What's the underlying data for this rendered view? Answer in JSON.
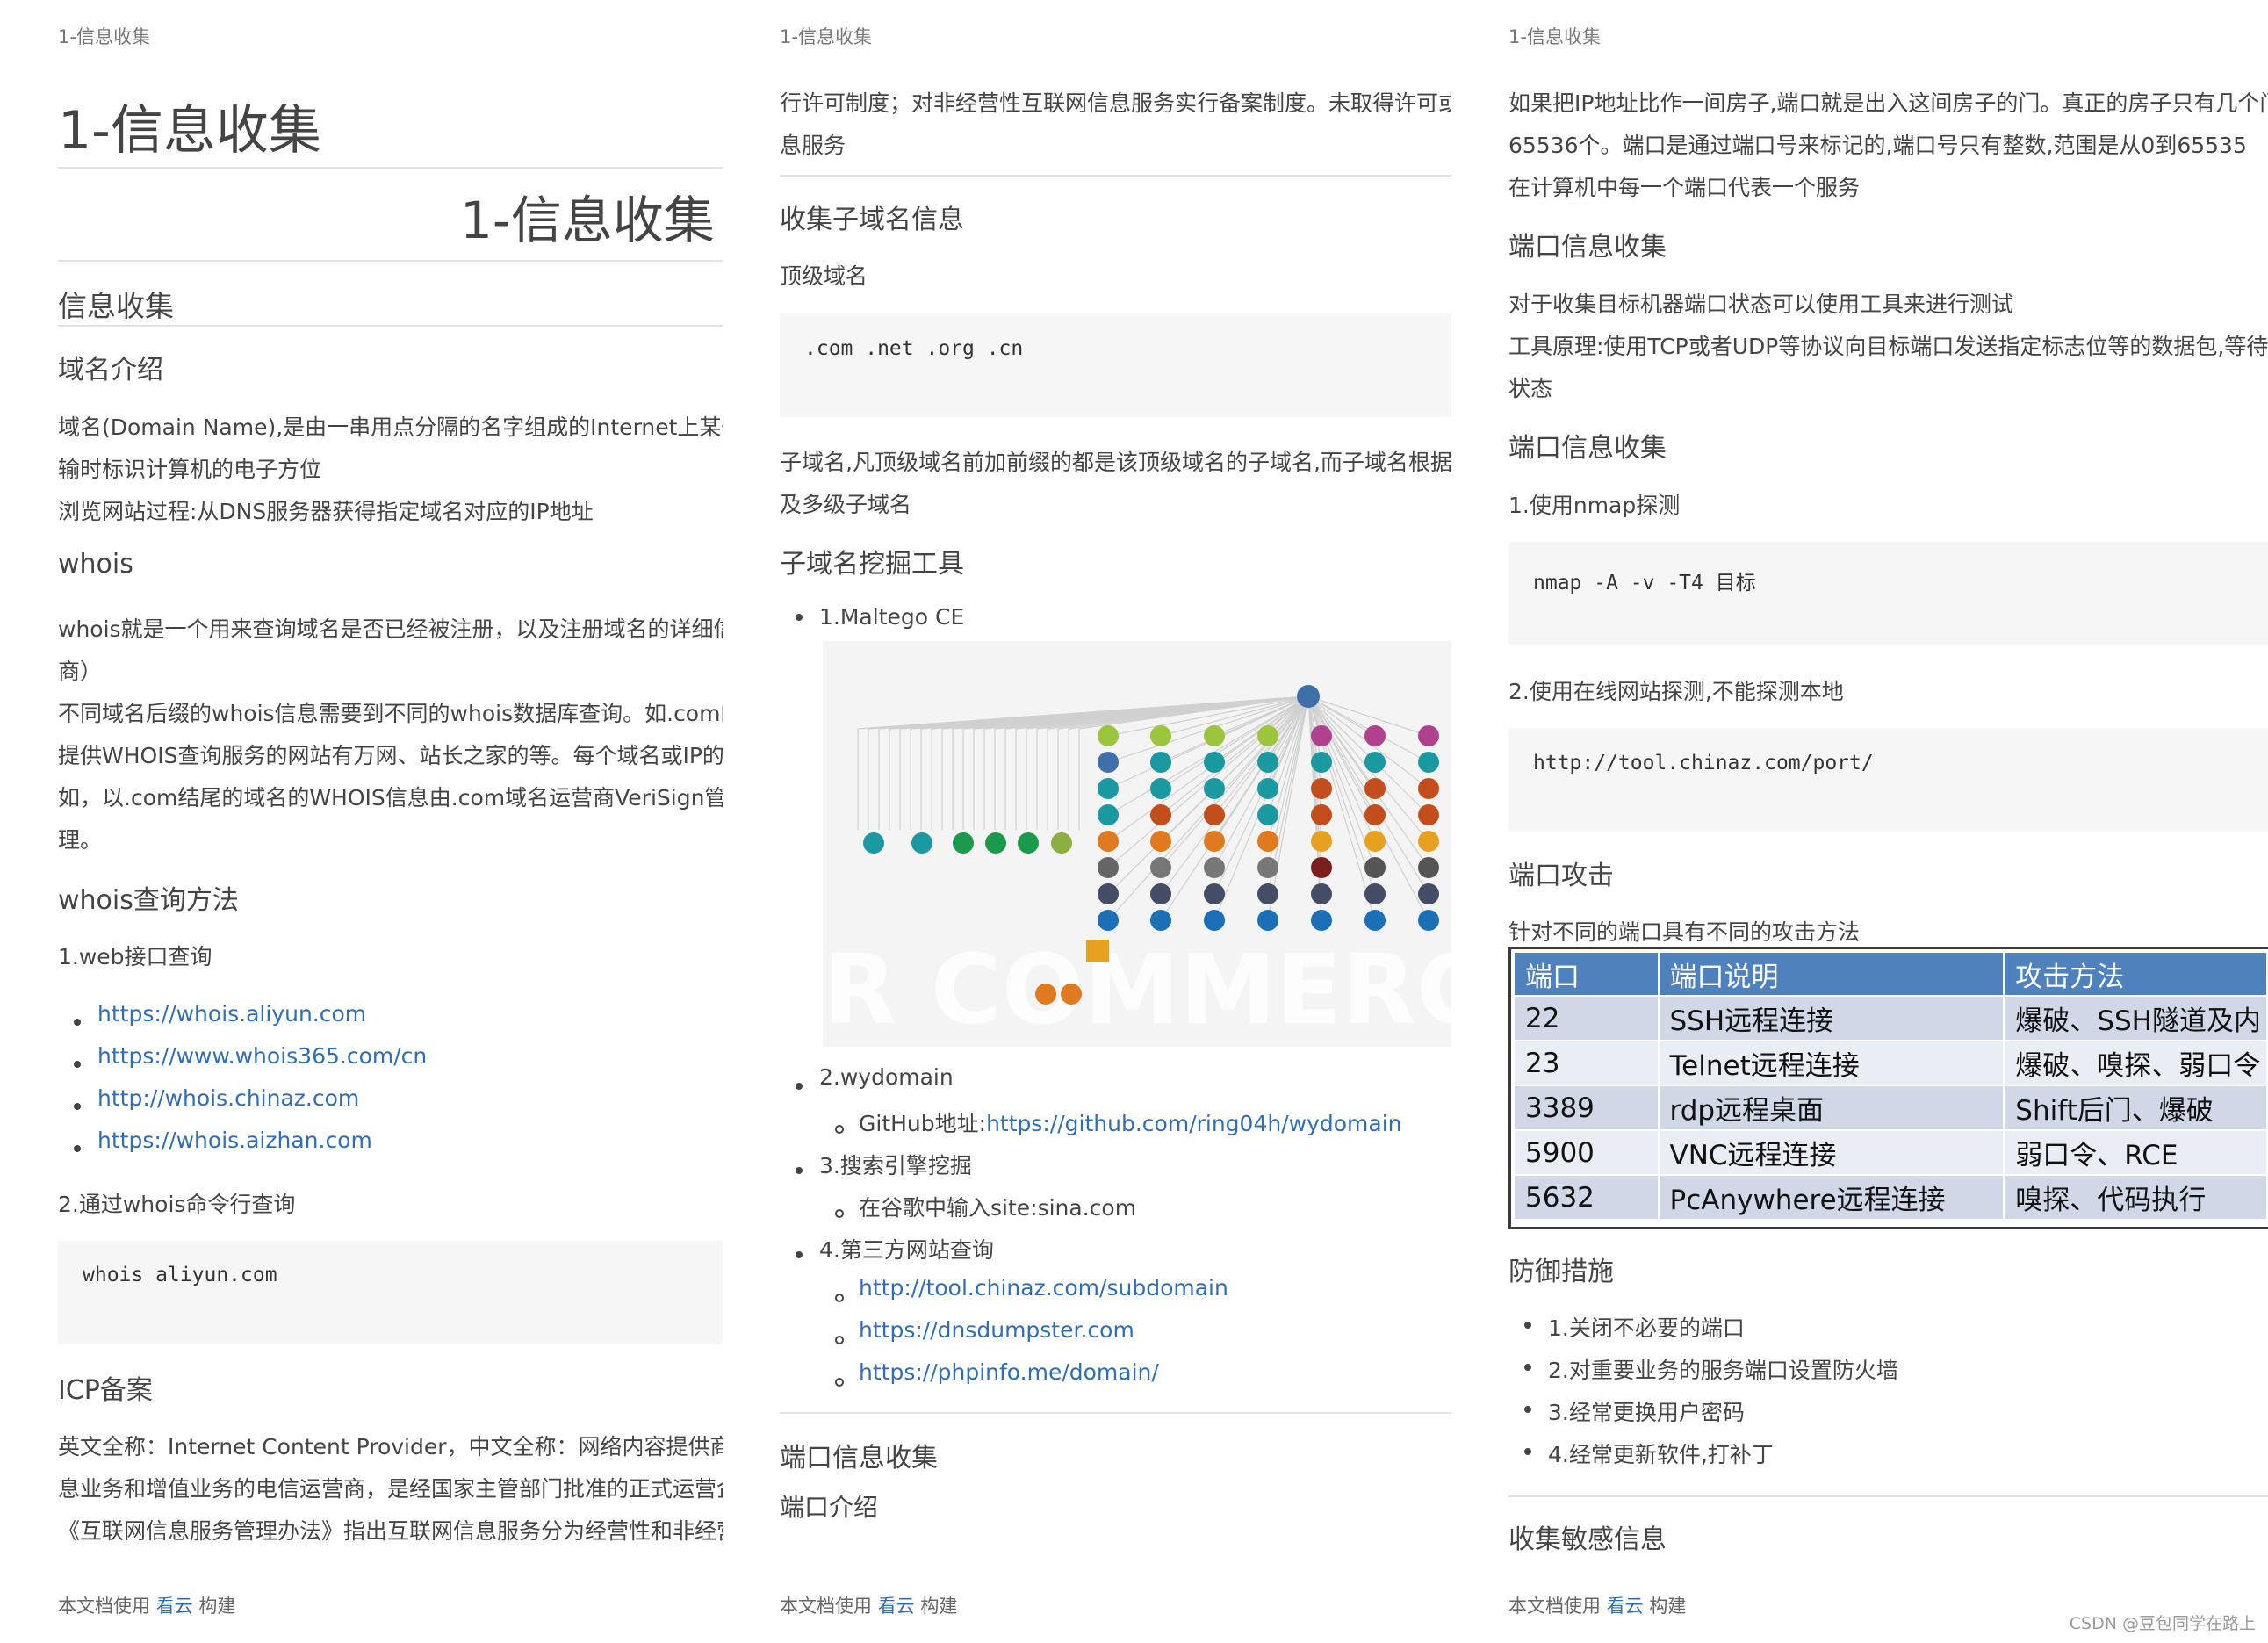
{
  "page_header": "1-信息收集",
  "footer": {
    "prefix": "本文档使用",
    "link": "看云",
    "suffix": "构建"
  },
  "watermark": "CSDN @豆包同学在路上",
  "col1": {
    "title": "1-信息收集",
    "title_center": "1-信息收集",
    "sec_info": "信息收集",
    "sec_domain": "域名介绍",
    "domain_p1a": "域名(Domain Name),是由一串用点分隔的名字组成的Internet上某一台",
    "domain_p1b": "输时标识计算机的电子方位",
    "domain_p2": "浏览网站过程:从DNS服务器获得指定域名对应的IP地址",
    "sec_whois": "whois",
    "whois_p1a": "whois就是一个用来查询域名是否已经被注册，以及注册域名的详细信息",
    "whois_p1b": "商）",
    "whois_p2a": "不同域名后缀的whois信息需要到不同的whois数据库查询。如.com的w",
    "whois_p2b": "提供WHOIS查询服务的网站有万网、站长之家的等。每个域名或IP的W",
    "whois_p2c": "如，以.com结尾的域名的WHOIS信息由.com域名运营商VeriSign管 理",
    "whois_p2d": "理。",
    "sec_whois_method": "whois查询方法",
    "web_query": "1.web接口查询",
    "links": [
      "https://whois.aliyun.com",
      "https://www.whois365.com/cn",
      "http://whois.chinaz.com",
      "https://whois.aizhan.com"
    ],
    "cmd_query": "2.通过whois命令行查询",
    "code": "whois aliyun.com",
    "sec_icp": "ICP备案",
    "icp_a": "英文全称：Internet Content Provider，中文全称：网络内容提供商。I",
    "icp_b": "息业务和增值业务的电信运营商，是经国家主管部门批准的正式运营企业",
    "icp_c": "《互联网信息服务管理办法》指出互联网信息服务分为经营性和非经营性"
  },
  "col2": {
    "p1a": "行许可制度；对非经营性互联网信息服务实行备案制度。未取得许可或 者",
    "p1b": "息服务",
    "sec_subdomain": "收集子域名信息",
    "top_domain": "顶级域名",
    "code": ".com .net .org .cn",
    "sub_a": "子域名,凡顶级域名前加前缀的都是该顶级域名的子域名,而子域名根据技术",
    "sub_b": "及多级子域名",
    "sec_tools": "子域名挖掘工具",
    "tool1": "1.Maltego CE",
    "graph_watermark": "R COMMERCIAL",
    "tool2": "2.wydomain",
    "github_label": "GitHub地址:",
    "github_link": "https://github.com/ring04h/wydomain",
    "tool3": "3.搜索引擎挖掘",
    "google": "在谷歌中输入site:sina.com",
    "tool4": "4.第三方网站查询",
    "sites": [
      "http://tool.chinaz.com/subdomain",
      "https://dnsdumpster.com",
      "https://phpinfo.me/domain/"
    ],
    "sec_port": "端口信息收集",
    "port_intro": "端口介绍"
  },
  "col3": {
    "p1a": "如果把IP地址比作一间房子,端口就是出入这间房子的门。真正的房子只有几个门,但",
    "p1b": "65536个。端口是通过端口号来标记的,端口号只有整数,范围是从0到65535",
    "p2": "在计算机中每一个端口代表一个服务",
    "sec_port1": "端口信息收集",
    "tool_p1": "对于收集目标机器端口状态可以使用工具来进行测试",
    "tool_p2a": "工具原理:使用TCP或者UDP等协议向目标端口发送指定标志位等的数据包,等待目标",
    "tool_p2b": "状态",
    "sec_port2": "端口信息收集",
    "nmap_label": "1.使用nmap探测",
    "nmap_code": "nmap -A -v -T4 目标",
    "online_label": "2.使用在线网站探测,不能探测本地",
    "online_code": "http://tool.chinaz.com/port/",
    "sec_attack": "端口攻击",
    "attack_p": "针对不同的端口具有不同的攻击方法",
    "table": {
      "headers": [
        "端口",
        "端口说明",
        "攻击方法"
      ],
      "rows": [
        [
          "22",
          "SSH远程连接",
          "爆破、SSH隧道及内"
        ],
        [
          "23",
          "Telnet远程连接",
          "爆破、嗅探、弱口令"
        ],
        [
          "3389",
          "rdp远程桌面",
          "Shift后门、爆破"
        ],
        [
          "5900",
          "VNC远程连接",
          "弱口令、RCE"
        ],
        [
          "5632",
          "PcAnywhere远程连接",
          "嗅探、代码执行"
        ]
      ]
    },
    "sec_defense": "防御措施",
    "defense": [
      "1.关闭不必要的端口",
      "2.对重要业务的服务端口设置防火墙",
      "3.经常更换用户密码",
      "4.经常更新软件,打补丁"
    ],
    "sec_sensitive": "收集敏感信息"
  }
}
